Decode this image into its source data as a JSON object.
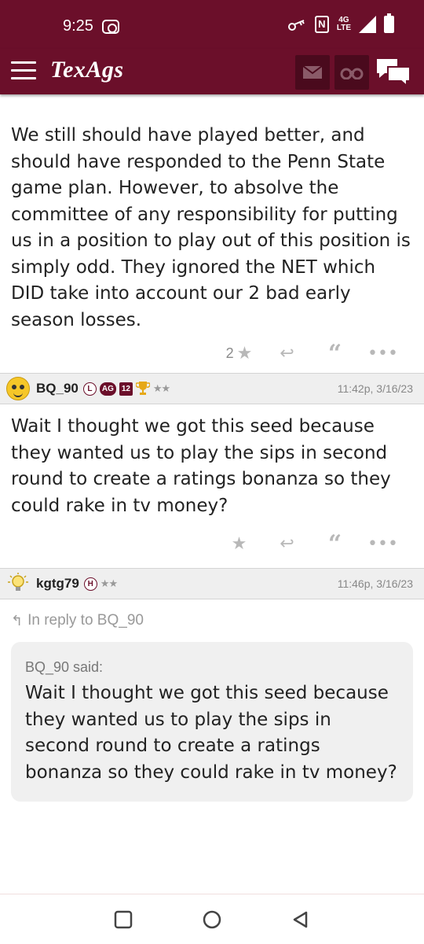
{
  "status_bar": {
    "time": "9:25",
    "network": [
      "4G",
      "LTE"
    ],
    "icons": [
      "screen-record-icon",
      "key-icon",
      "nfc-icon",
      "signal-icon",
      "battery-icon"
    ]
  },
  "header": {
    "logo": "TexAgs",
    "icons": [
      "menu-icon",
      "mail-icon",
      "binoculars-icon",
      "chat-icon"
    ],
    "colors": {
      "maroon": "#6b0f2a",
      "button_dark": "#4a0a1d"
    }
  },
  "posts": [
    {
      "body": "We still should have played better, and should have responded to the Penn State game plan. However, to absolve the committee of any responsibility for putting us in a position to play out of this position is simply odd. They ignored the NET which DID take into account our 2 bad early season losses.",
      "star_count": "2"
    },
    {
      "username": "BQ_90",
      "badges": [
        "L",
        "AG",
        "12"
      ],
      "rank_stars": "★★",
      "timestamp": "11:42p, 3/16/23",
      "body": "Wait I thought we got this seed because they wanted us to play the sips in second round to create a ratings bonanza so they could rake in tv money?"
    },
    {
      "username": "kgtg79",
      "badges": [
        "H"
      ],
      "rank_stars": "★★",
      "timestamp": "11:46p, 3/16/23",
      "reply_to": "In reply to BQ_90",
      "quote_author": "BQ_90 said:",
      "quote_text": "Wait I thought we got this seed because they wanted us to play the sips in second round to create a ratings bonanza so they could rake in tv money?"
    }
  ],
  "nav": [
    "recents-icon",
    "home-icon",
    "back-icon"
  ]
}
